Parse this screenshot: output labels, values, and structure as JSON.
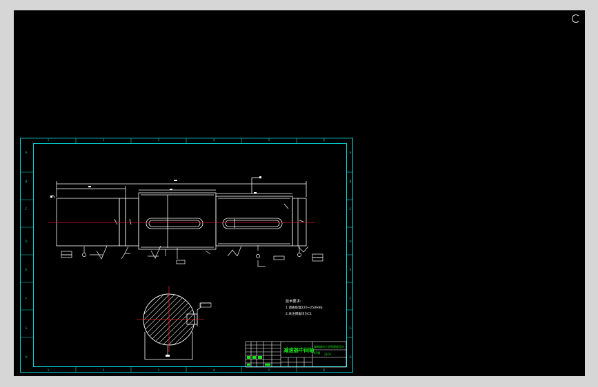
{
  "colors": {
    "canvas": "#000000",
    "frame": "#00d7d7",
    "outline": "#ffffff",
    "center_line": "#e01818",
    "title_text": "#19e619"
  },
  "border_zone_labels": {
    "top": [
      "1",
      "2",
      "3",
      "4",
      "5",
      "6"
    ],
    "bottom": [
      "1",
      "2",
      "3",
      "4",
      "5",
      "6"
    ],
    "left": [
      "A",
      "B",
      "C",
      "D",
      "E",
      "F",
      "G",
      "H"
    ],
    "right": [
      "A",
      "B",
      "C",
      "D",
      "E",
      "F",
      "G",
      "H"
    ]
  },
  "technical_requirements": {
    "heading": "技术要求:",
    "items": [
      "1.调质处理220~250HBS",
      "2.未注倒角均为C1"
    ]
  },
  "title_block": {
    "part_name": "减速器中间轴",
    "school": "湖南城市工学院课程设计",
    "material": "45钢",
    "drawing_no": "ZJ-01"
  },
  "icons": {
    "busy": "loading-spinner-icon"
  }
}
